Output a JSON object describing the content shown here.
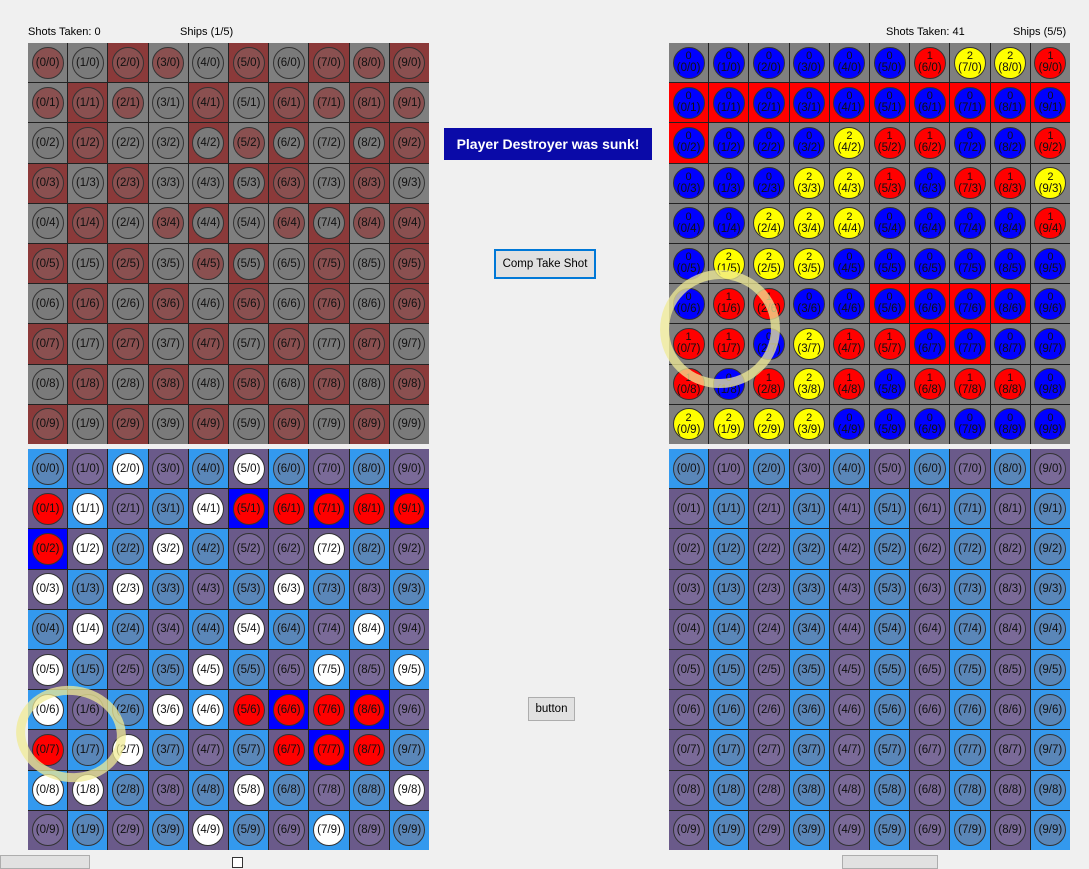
{
  "labels": {
    "left_shots": "Shots Taken: 0",
    "left_ships": "Ships (1/5)",
    "right_shots": "Shots Taken: 41",
    "right_ships": "Ships (5/5)"
  },
  "message": "Player Destroyer was sunk!",
  "buttons": {
    "comp_take_shot": "Comp Take Shot",
    "generic": "button"
  },
  "colors": {
    "grid_gray": "#7f7f7f",
    "grid_maroon": "#8b3a3a",
    "grid_sky": "#3399ee",
    "grid_purple": "#6a5a8a",
    "cell_red": "#ff0000",
    "cell_blue": "#0000ff",
    "cell_steel": "#4a7fbf",
    "circle_blue": "#0000ff",
    "circle_red": "#ff0000",
    "circle_yellow": "#ffff00",
    "circle_white": "#ffffff",
    "circle_steel": "#5a86b8",
    "circle_gray": "#7a7a7a",
    "circle_reddish": "#8a5050",
    "circle_purple": "#7a6a98"
  },
  "grids": {
    "top_left": {
      "rows": [
        "GM GG MM GM GG MM GG MM GM MM",
        "GM MM GM GG MM GG MM GM MM GM",
        "GG MM GG GG MG GM MG GG MG MM",
        "MM GG MM GG GG MG MM GG MM GG",
        "GG MM GG GM MG GG GM MG GM MM",
        "MM GG MM GG GM MG GG MM GG MM",
        "GG MM GG MM GG MM GG MM GG MM",
        "MM GG MM GG MM GG MM GG MM GG",
        "GG MM GG MM GG MM GG MM GG MM",
        "MM GG MM GG MM GG MM GG MM GG"
      ]
    },
    "top_right": {
      "rows": [
        "B0 B0 B0 B0 B0 B0 R1 Y2 Y2 R1",
        "B0 B0 B0 B0 B0 B0 B0 B0 B0 B0",
        "B0 B0 B0 B0 Y2 R1 R1 B0 B0 R1",
        "B0 B0 B0 Y2 Y2 R1 B0 R1 R1 Y2",
        "B0 B0 Y2 Y2 Y2 B0 B0 B0 B0 R1",
        "B0 Y2 Y2 Y2 B0 B0 B0 B0 B0 B0",
        "B0 R1 R1 B0 B0 B0 B0 B0 B0 B0",
        "R1 R1 B0 Y2 R1 R1 B0 B0 B0 B0",
        "R1 B0 R1 Y2 R1 B0 R1 R1 R1 B0",
        "Y2 Y2 Y2 Y2 B0 B0 B0 B0 B0 B0"
      ],
      "cell_overrides": {
        "1": "RRRRRRRRRR",
        "2": "RGGGGGGGGG",
        "6": "GGGGGRRRRG",
        "7": "GGGGGGRRGG"
      }
    },
    "bottom_left": {
      "rows": [
        "SS PP WW PP SS WW SS PP SS PP",
        "RR WW PP SS WW RR RR RR RR RR",
        "RR WW SS WW SS PP PP WW SS PP",
        "WW SS WW SS PP SS WW SS PP SS",
        "SS WW SS PP SS WW SS PP WW PP",
        "WW SS PP SS WW SS PP WW PP WW",
        "WW PP SS WW WW RR RR RR RR PP",
        "RR SS WW SS PP SS RR RR RR SS",
        "WW WW SS PP SS WW SS PP SS WW",
        "PP SS PP SS WW SS PP WW PP SS"
      ]
    },
    "bottom_right": {}
  }
}
